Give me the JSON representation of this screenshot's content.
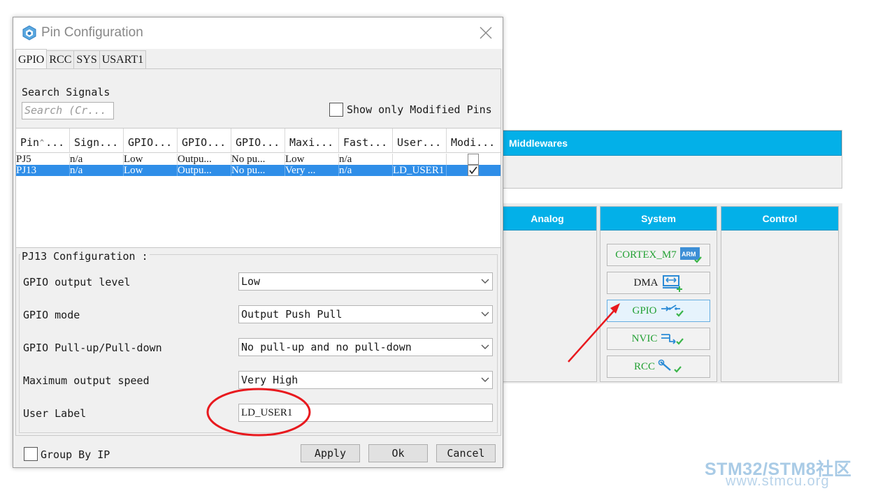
{
  "dialog": {
    "title": "Pin Configuration",
    "tabs": [
      "GPIO",
      "RCC",
      "SYS",
      "USART1"
    ],
    "search": {
      "label": "Search Signals",
      "placeholder": "Search (Cr..."
    },
    "show_modified": {
      "label": "Show only Modified Pins",
      "checked": false
    },
    "table": {
      "headers": [
        "Pin ...",
        "Sign...",
        "GPIO...",
        "GPIO...",
        "GPIO...",
        "Maxi...",
        "Fast...",
        "User...",
        "Modi..."
      ],
      "rows": [
        {
          "pin": "PJ5",
          "signal": "n/a",
          "level": "Low",
          "mode": "Outpu...",
          "pull": "No pu...",
          "speed": "Low",
          "fast": "n/a",
          "user": "",
          "modified": false
        },
        {
          "pin": "PJ13",
          "signal": "n/a",
          "level": "Low",
          "mode": "Outpu...",
          "pull": "No pu...",
          "speed": "Very ...",
          "fast": "n/a",
          "user": "LD_USER1",
          "modified": true
        }
      ]
    },
    "config": {
      "title": "PJ13 Configuration :",
      "output_level": {
        "label": "GPIO output level",
        "value": "Low"
      },
      "mode": {
        "label": "GPIO mode",
        "value": "Output Push Pull"
      },
      "pull": {
        "label": "GPIO Pull-up/Pull-down",
        "value": "No pull-up and no pull-down"
      },
      "speed": {
        "label": "Maximum output speed",
        "value": "Very High"
      },
      "user_label": {
        "label": "User Label",
        "value": "LD_USER1"
      }
    },
    "group_by_ip": {
      "label": "Group By IP",
      "checked": false
    },
    "buttons": {
      "apply": "Apply",
      "ok": "Ok",
      "cancel": "Cancel"
    }
  },
  "background": {
    "middlewares": "Middlewares",
    "categories": [
      "Analog",
      "System",
      "Control"
    ],
    "system_items": [
      {
        "label": "CORTEX_M7",
        "icon": "arm-chip-icon"
      },
      {
        "label": "DMA",
        "icon": "dma-icon"
      },
      {
        "label": "GPIO",
        "icon": "gpio-switch-icon"
      },
      {
        "label": "NVIC",
        "icon": "nvic-icon"
      },
      {
        "label": "RCC",
        "icon": "wrench-icon"
      }
    ],
    "arm_badge": "ARM"
  },
  "watermark": {
    "line1": "STM32/STM8社区",
    "line2": "www.stmcu.org"
  },
  "colors": {
    "accent": "#03b0e8",
    "selection": "#2f8ee8",
    "annotation": "#e8191e",
    "ok_green": "#22a033"
  }
}
